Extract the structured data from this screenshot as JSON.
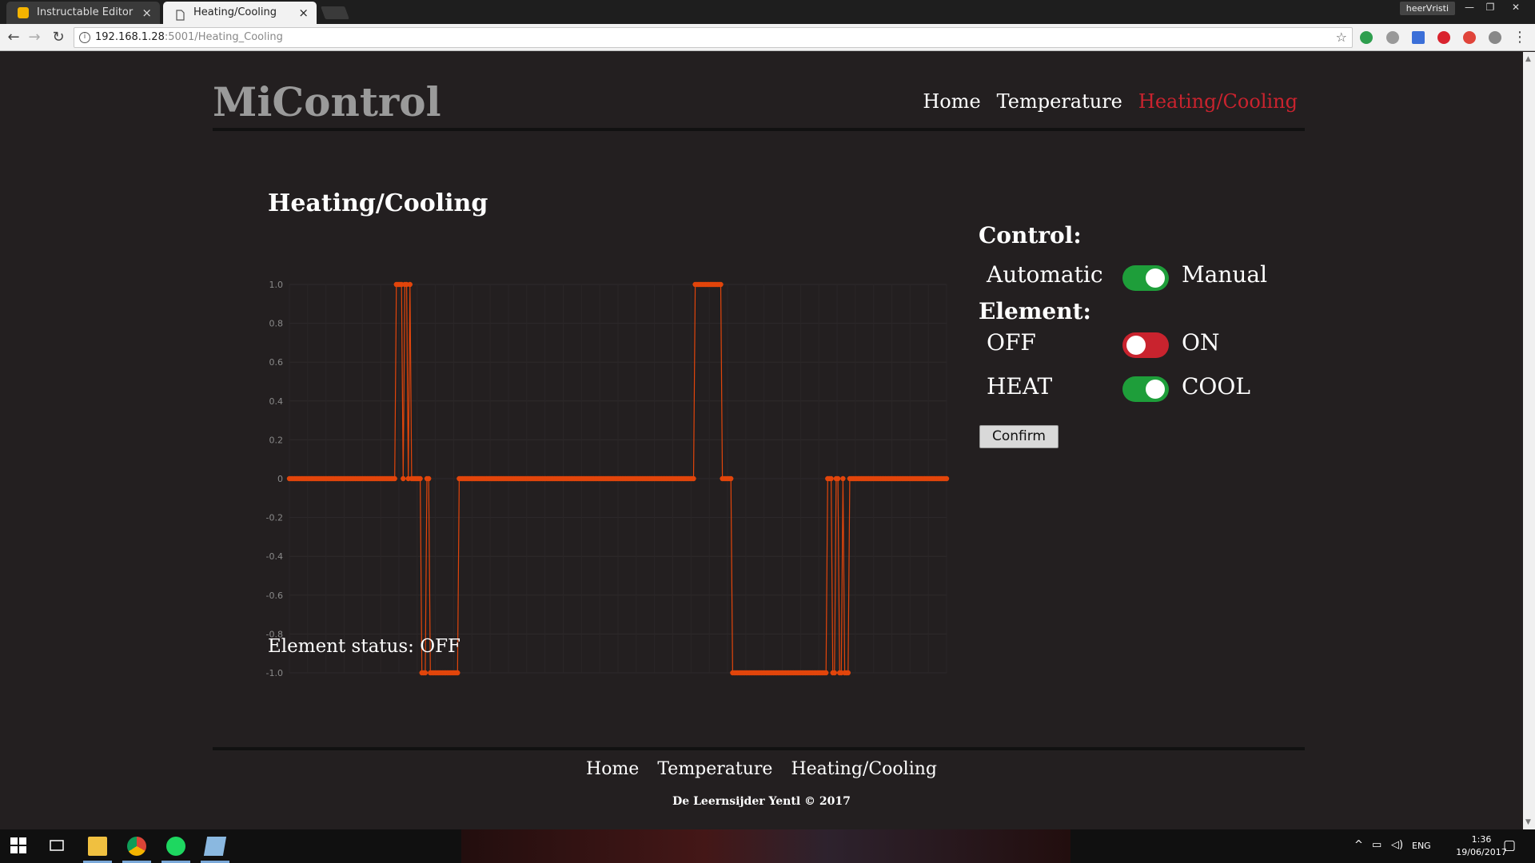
{
  "browser": {
    "tabs": [
      {
        "title": "Instructable Editor",
        "close": "×"
      },
      {
        "title": "Heating/Cooling",
        "close": "×"
      }
    ],
    "profile": "heerVristi",
    "window_controls": [
      "—",
      "❐",
      "✕"
    ],
    "url_host": "192.168.1.28",
    "url_rest": ":5001/Heating_Cooling"
  },
  "site": {
    "brand": "MiControl",
    "nav": [
      "Home",
      "Temperature",
      "Heating/Cooling"
    ],
    "active_nav": "Heating/Cooling"
  },
  "main": {
    "title": "Heating/Cooling",
    "status_label": "Element status:",
    "status_value": "OFF"
  },
  "control": {
    "heading": "Control:",
    "mode_left": "Automatic",
    "mode_right": "Manual",
    "mode_state": "on",
    "element_heading": "Element:",
    "power_left": "OFF",
    "power_right": "ON",
    "power_state": "off",
    "direction_left": "HEAT",
    "direction_right": "COOL",
    "direction_state": "on",
    "confirm_label": "Confirm"
  },
  "chart_data": {
    "type": "line",
    "title": "",
    "xlabel": "",
    "ylabel": "",
    "ylim": [
      -1.0,
      1.0
    ],
    "yticks": [
      "1.0",
      "0.8",
      "0.6",
      "0.4",
      "0.2",
      "0",
      "-0.2",
      "-0.4",
      "-0.6",
      "-0.8",
      "-1.0"
    ],
    "grid": true,
    "color": "#e2450b",
    "series": [
      {
        "name": "",
        "values": [
          0,
          0,
          0,
          0,
          0,
          0,
          0,
          0,
          0,
          0,
          0,
          0,
          0,
          0,
          0,
          0,
          0,
          0,
          0,
          0,
          0,
          0,
          0,
          0,
          0,
          0,
          0,
          0,
          0,
          0,
          0,
          0,
          0,
          0,
          0,
          0,
          0,
          0,
          0,
          0,
          0,
          0,
          0,
          0,
          0,
          0,
          0,
          0,
          0,
          0,
          0,
          0,
          0,
          0,
          0,
          0,
          0,
          0,
          0,
          0,
          0,
          0,
          0,
          1,
          1,
          1,
          1,
          0,
          1,
          1,
          0,
          1,
          0,
          0,
          0,
          0,
          0,
          0,
          -1,
          -1,
          -1,
          0,
          0,
          -1,
          -1,
          -1,
          -1,
          -1,
          -1,
          -1,
          -1,
          -1,
          -1,
          -1,
          -1,
          -1,
          -1,
          -1,
          -1,
          -1,
          0,
          0,
          0,
          0,
          0,
          0,
          0,
          0,
          0,
          0,
          0,
          0,
          0,
          0,
          0,
          0,
          0,
          0,
          0,
          0,
          0,
          0,
          0,
          0,
          0,
          0,
          0,
          0,
          0,
          0,
          0,
          0,
          0,
          0,
          0,
          0,
          0,
          0,
          0,
          0,
          0,
          0,
          0,
          0,
          0,
          0,
          0,
          0,
          0,
          0,
          0,
          0,
          0,
          0,
          0,
          0,
          0,
          0,
          0,
          0,
          0,
          0,
          0,
          0,
          0,
          0,
          0,
          0,
          0,
          0,
          0,
          0,
          0,
          0,
          0,
          0,
          0,
          0,
          0,
          0,
          0,
          0,
          0,
          0,
          0,
          0,
          0,
          0,
          0,
          0,
          0,
          0,
          0,
          0,
          0,
          0,
          0,
          0,
          0,
          0,
          0,
          0,
          0,
          0,
          0,
          0,
          0,
          0,
          0,
          0,
          0,
          0,
          0,
          0,
          0,
          0,
          0,
          0,
          0,
          0,
          0,
          0,
          0,
          0,
          0,
          0,
          0,
          0,
          0,
          0,
          0,
          0,
          0,
          0,
          0,
          0,
          0,
          0,
          0,
          1,
          1,
          1,
          1,
          1,
          1,
          1,
          1,
          1,
          1,
          1,
          1,
          1,
          1,
          1,
          1,
          0,
          0,
          0,
          0,
          0,
          0,
          -1,
          -1,
          -1,
          -1,
          -1,
          -1,
          -1,
          -1,
          -1,
          -1,
          -1,
          -1,
          -1,
          -1,
          -1,
          -1,
          -1,
          -1,
          -1,
          -1,
          -1,
          -1,
          -1,
          -1,
          -1,
          -1,
          -1,
          -1,
          -1,
          -1,
          -1,
          -1,
          -1,
          -1,
          -1,
          -1,
          -1,
          -1,
          -1,
          -1,
          -1,
          -1,
          -1,
          -1,
          -1,
          -1,
          -1,
          -1,
          -1,
          -1,
          -1,
          -1,
          -1,
          -1,
          -1,
          -1,
          0,
          0,
          0,
          -1,
          -1,
          0,
          0,
          -1,
          -1,
          0,
          -1,
          -1,
          -1,
          0,
          0,
          0,
          0,
          0,
          0,
          0,
          0,
          0,
          0,
          0,
          0,
          0,
          0,
          0,
          0,
          0,
          0,
          0,
          0,
          0,
          0,
          0,
          0,
          0,
          0,
          0,
          0,
          0,
          0,
          0,
          0,
          0,
          0,
          0,
          0,
          0,
          0,
          0,
          0,
          0,
          0,
          0,
          0,
          0,
          0,
          0,
          0,
          0,
          0,
          0,
          0,
          0,
          0,
          0,
          0,
          0,
          0
        ]
      }
    ]
  },
  "footer": {
    "nav": [
      "Home",
      "Temperature",
      "Heating/Cooling"
    ],
    "copyright": "De Leernsijder Yentl © 2017"
  },
  "taskbar": {
    "lang": "ENG",
    "time": "1:36",
    "date": "19/06/2017"
  }
}
